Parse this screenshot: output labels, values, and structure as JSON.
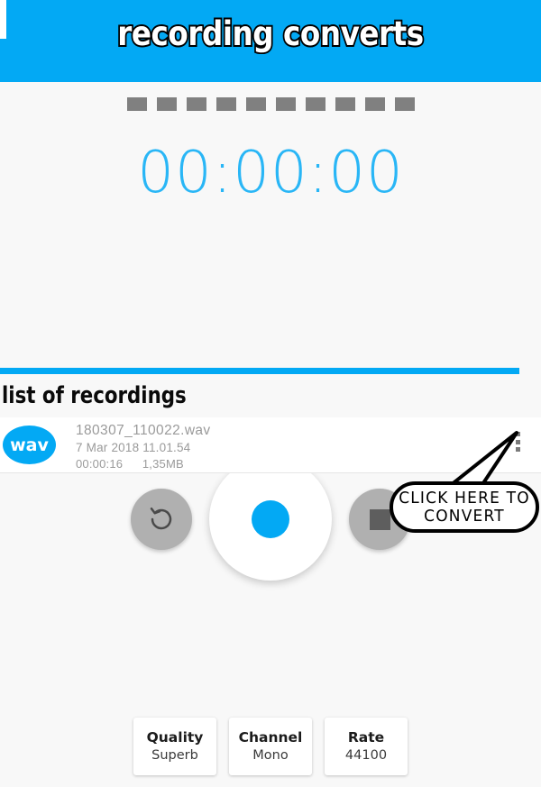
{
  "app": {
    "title": "recording converts",
    "header_color": "#03a9f4",
    "background_color": "#f8f8f8"
  },
  "level_meter": {
    "segment_count": 10,
    "active_count": 0,
    "segment_color": "#808080"
  },
  "timer": {
    "value": "00:00:00",
    "color": "#29b6f6"
  },
  "controls": {
    "reset_icon": "restart-circular-arrow-icon",
    "record_icon": "record-dot-icon",
    "stop_icon": "stop-square-icon",
    "record_color": "#03a9f4",
    "button_color": "#b0b0b0"
  },
  "list": {
    "header": "list of recordings",
    "items": [
      {
        "format_badge": "wav",
        "filename": "180307_110022.wav",
        "date": "7 Mar 2018 11.01.54",
        "duration": "00:00:16",
        "size": "1,35MB",
        "overflow_icon": "three-dot-vertical-menu-icon"
      }
    ]
  },
  "annotation": {
    "line1": "CLICK HERE TO",
    "line2": "CONVERT"
  },
  "settings": [
    {
      "label": "Quality",
      "value": "Superb"
    },
    {
      "label": "Channel",
      "value": "Mono"
    },
    {
      "label": "Rate",
      "value": "44100"
    }
  ]
}
